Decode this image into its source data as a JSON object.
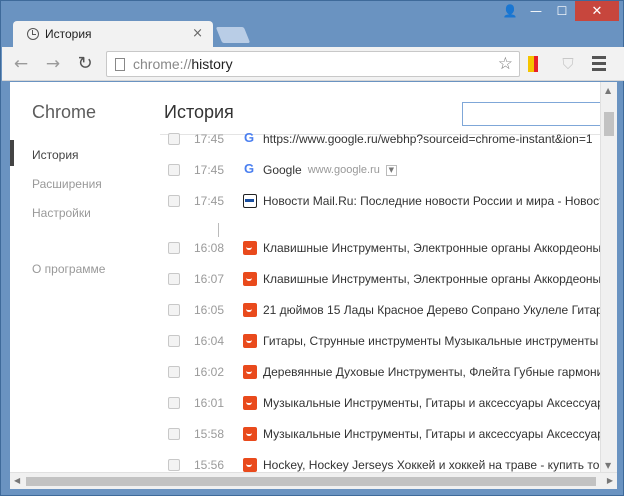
{
  "window": {
    "close_glyph": "✕",
    "minimize_glyph": "—",
    "maximize_glyph": "☐",
    "user_glyph": "👤"
  },
  "tab": {
    "title": "История",
    "close_glyph": "×"
  },
  "toolbar": {
    "back_glyph": "←",
    "forward_glyph": "→",
    "reload_glyph": "↻",
    "url_scheme": "chrome://",
    "url_path": "history",
    "star_glyph": "☆"
  },
  "sidebar": {
    "title": "Chrome",
    "items": [
      {
        "label": "История",
        "active": true
      },
      {
        "label": "Расширения",
        "active": false
      },
      {
        "label": "Настройки",
        "active": false
      },
      {
        "label": "О программе",
        "active": false
      }
    ]
  },
  "main": {
    "title": "История",
    "search_value": ""
  },
  "history": [
    {
      "time": "17:45",
      "icon": "google-icon",
      "title": "https://www.google.ru/webhp?sourceid=chrome-instant&ion=1",
      "domain": ""
    },
    {
      "time": "17:45",
      "icon": "google-icon",
      "title": "Google",
      "domain": "www.google.ru"
    },
    {
      "time": "17:45",
      "icon": "mailru-icon",
      "title": "Новости Mail.Ru: Последние новости России и мира - Новости",
      "domain": ""
    },
    {
      "time": "16:08",
      "icon": "aliexpress-icon",
      "title": "Клавишные Инструменты, Электронные органы Аккордеоны",
      "domain": ""
    },
    {
      "time": "16:07",
      "icon": "aliexpress-icon",
      "title": "Клавишные Инструменты, Электронные органы Аккордеоны",
      "domain": ""
    },
    {
      "time": "16:05",
      "icon": "aliexpress-icon",
      "title": "21 дюймов 15 Лады Красное Дерево Сопрано Укулеле Гитар",
      "domain": ""
    },
    {
      "time": "16:04",
      "icon": "aliexpress-icon",
      "title": "Гитары, Струнные инструменты Музыкальные инструменты -",
      "domain": ""
    },
    {
      "time": "16:02",
      "icon": "aliexpress-icon",
      "title": "Деревянные Духовые Инструменты, Флейта Губные гармони",
      "domain": ""
    },
    {
      "time": "16:01",
      "icon": "aliexpress-icon",
      "title": "Музыкальные Инструменты, Гитары и аксессуары Аксессуары",
      "domain": ""
    },
    {
      "time": "15:58",
      "icon": "aliexpress-icon",
      "title": "Музыкальные Инструменты, Гитары и аксессуары Аксессуары",
      "domain": ""
    },
    {
      "time": "15:56",
      "icon": "aliexpress-icon",
      "title": "Hockey, Hockey Jerseys Хоккей и хоккей на траве - купить тов",
      "domain": ""
    }
  ],
  "colors": {
    "frame": "#6a93c1",
    "close": "#c7463d",
    "search_border": "#7fa7d8"
  }
}
